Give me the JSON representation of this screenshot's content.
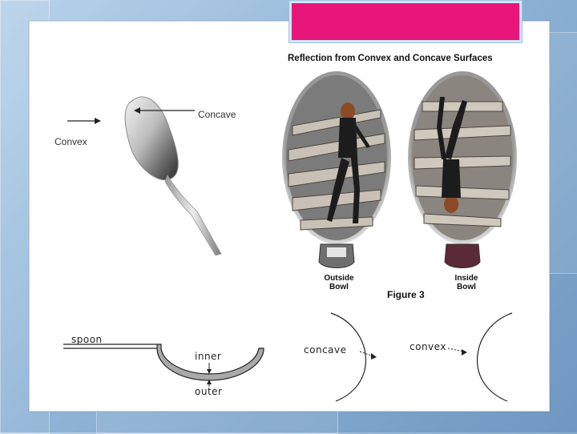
{
  "figure": {
    "title": "Reflection from Convex and Concave Surfaces",
    "label": "Figure 3",
    "outside_caption_line1": "Outside",
    "outside_caption_line2": "Bowl",
    "inside_caption_line1": "Inside",
    "inside_caption_line2": "Bowl"
  },
  "spoon_photo": {
    "convex_label": "Convex",
    "concave_label": "Concave"
  },
  "cross_section": {
    "spoon_label": "spoon",
    "inner_label": "inner",
    "outer_label": "outer"
  },
  "curves": {
    "concave_label": "concave",
    "convex_label": "convex"
  },
  "colors": {
    "title_box": "#e8167a",
    "background": "#8fb4d6"
  }
}
